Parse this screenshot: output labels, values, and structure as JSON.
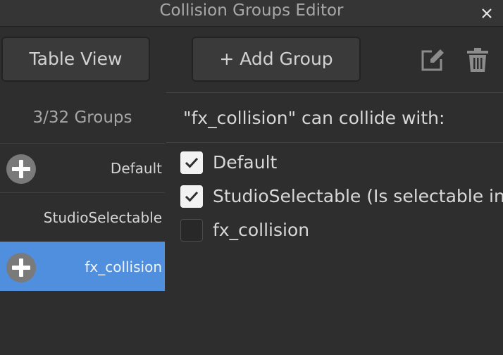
{
  "window": {
    "title": "Collision Groups Editor"
  },
  "toolbar": {
    "table_view_label": "Table View",
    "add_group_label": "+ Add Group"
  },
  "groups": {
    "count_label": "3/32 Groups",
    "items": [
      {
        "label": "Default",
        "show_plus": true,
        "selected": false
      },
      {
        "label": "StudioSelectable",
        "show_plus": false,
        "selected": false
      },
      {
        "label": "fx_collision",
        "show_plus": true,
        "selected": true
      }
    ]
  },
  "collide": {
    "heading": "\"fx_collision\" can collide with:",
    "items": [
      {
        "label": "Default",
        "checked": true
      },
      {
        "label": "StudioSelectable (Is selectable in v",
        "checked": true
      },
      {
        "label": "fx_collision",
        "checked": false
      }
    ]
  },
  "colors": {
    "background": "#2e2e2e",
    "selected_row": "#4f8fde",
    "checkbox_checked": "#f2f2f2"
  },
  "icons": [
    "close-icon",
    "edit-icon",
    "trash-icon",
    "plus-circle-icon",
    "checkmark-icon"
  ]
}
